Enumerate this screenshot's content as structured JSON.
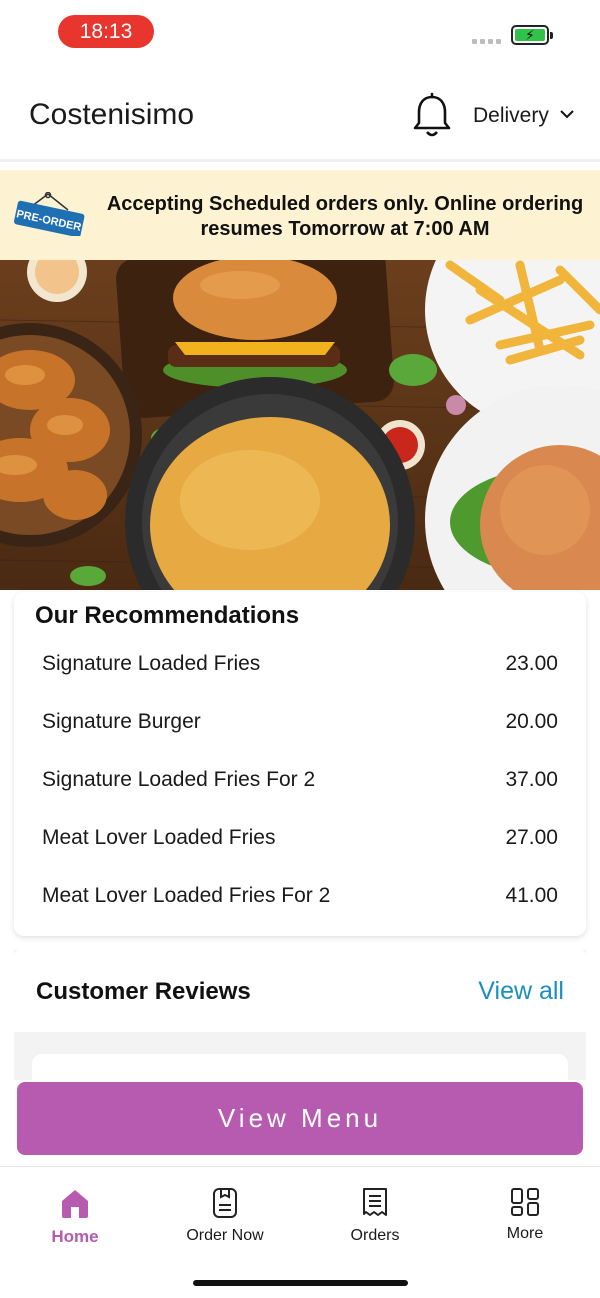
{
  "status_bar": {
    "time": "18:13"
  },
  "header": {
    "title": "Costenisimo",
    "delivery_mode": "Delivery"
  },
  "banner": {
    "tag": "PRE-ORDER",
    "message": "Accepting Scheduled orders only. Online ordering resumes Tomorrow at 7:00 AM"
  },
  "recommendations": {
    "title": "Our Recommendations",
    "items": [
      {
        "name": "Signature Loaded Fries",
        "price": "23.00"
      },
      {
        "name": "Signature Burger",
        "price": "20.00"
      },
      {
        "name": "Signature Loaded Fries For 2",
        "price": "37.00"
      },
      {
        "name": "Meat Lover Loaded Fries",
        "price": "27.00"
      },
      {
        "name": "Meat Lover Loaded Fries For 2",
        "price": "41.00"
      }
    ]
  },
  "reviews": {
    "title": "Customer Reviews",
    "view_all": "View all"
  },
  "cta": {
    "label": "View Menu"
  },
  "tab_bar": {
    "tabs": [
      {
        "label": "Home",
        "icon": "home-icon",
        "active": true
      },
      {
        "label": "Order Now",
        "icon": "order-now-icon",
        "active": false
      },
      {
        "label": "Orders",
        "icon": "receipt-icon",
        "active": false
      },
      {
        "label": "More",
        "icon": "grid-icon",
        "active": false
      }
    ]
  },
  "colors": {
    "accent": "#b65bb0",
    "link": "#1a8fbf",
    "banner_bg": "#fdf3d3",
    "time_pill": "#e8362f",
    "preorder_tag": "#1f6fb3"
  }
}
